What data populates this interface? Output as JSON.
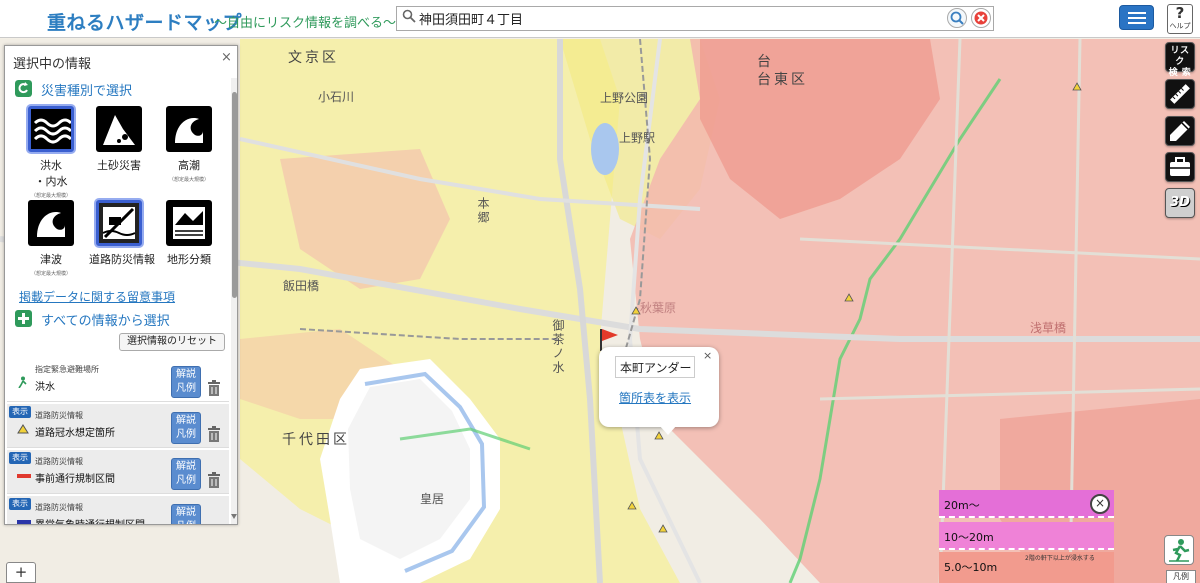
{
  "header": {
    "title": "重ねるハザードマップ",
    "subtitle": "～自由にリスク情報を調べる～",
    "search_value": "神田須田町４丁目",
    "help_label": "ヘルプ",
    "help_symbol": "?"
  },
  "panel": {
    "title": "選択中の情報",
    "close": "×",
    "section_disaster": "災害種別で選択",
    "hazards": [
      {
        "label": "洪水",
        "label2": "・内水",
        "note": "（想定最大規模）",
        "icon": "flood-icon"
      },
      {
        "label": "土砂災害",
        "icon": "landslide-icon"
      },
      {
        "label": "高潮",
        "note": "（想定最大規模）",
        "icon": "storm-surge-icon"
      },
      {
        "label": "津波",
        "note": "（想定最大規模）",
        "icon": "tsunami-icon"
      },
      {
        "label": "道路防災情報",
        "icon": "road-disaster-icon"
      },
      {
        "label": "地形分類",
        "icon": "terrain-icon"
      }
    ],
    "notes_link": "掲載データに関する留意事項",
    "section_all": "すべての情報から選択",
    "reset_button": "選択情報のリセット",
    "legend_button": "解説凡例",
    "legend_line1": "解説",
    "legend_line2": "凡例",
    "show_tag": "表示",
    "layers": [
      {
        "category": "指定緊急避難場所",
        "name": "洪水",
        "shown": false
      },
      {
        "category": "道路防災情報",
        "name": "道路冠水想定箇所",
        "shown": true
      },
      {
        "category": "道路防災情報",
        "name": "事前通行規制区間",
        "shown": true
      },
      {
        "category": "道路防災情報",
        "name": "異常気象時通行規制区間",
        "shown": true
      }
    ]
  },
  "map": {
    "labels": {
      "bunkyo": "文京区",
      "taito": "台東区",
      "chiyoda": "千代田区",
      "koishikawa": "小石川",
      "ueno_park": "上野公園",
      "ueno_st": "上野駅",
      "iidabashi": "飯田橋",
      "kokyo": "皇居",
      "akihabara": "秋葉原",
      "asakusabashi": "浅草橋",
      "hongo": "本郷",
      "ochanomizu": "御茶ノ水"
    },
    "colors": {
      "base": "#f1ede4",
      "flood_light": "#f7f08e",
      "flood_pink": "#f3b7ae",
      "flood_red": "#ef9a8e",
      "water": "#a9c7ee",
      "road_green": "#5fcf74"
    }
  },
  "popup": {
    "name": "本町アンダー",
    "link": "箇所表を表示",
    "close": "×"
  },
  "toolbar": {
    "risk_search_line1": "リスク",
    "risk_search_line2": "検 索",
    "three_d": "3D"
  },
  "depth_legend": {
    "rows": [
      {
        "label": "20m～",
        "color": "#e46fd7"
      },
      {
        "label": "10～20m",
        "color": "#ef82d7"
      },
      {
        "label": "5.0～10m",
        "color": "#f29b8e",
        "note": "2階の軒下以上が浸水する"
      }
    ],
    "close": "×"
  },
  "zoom_in": "+",
  "corner_label": "凡例"
}
